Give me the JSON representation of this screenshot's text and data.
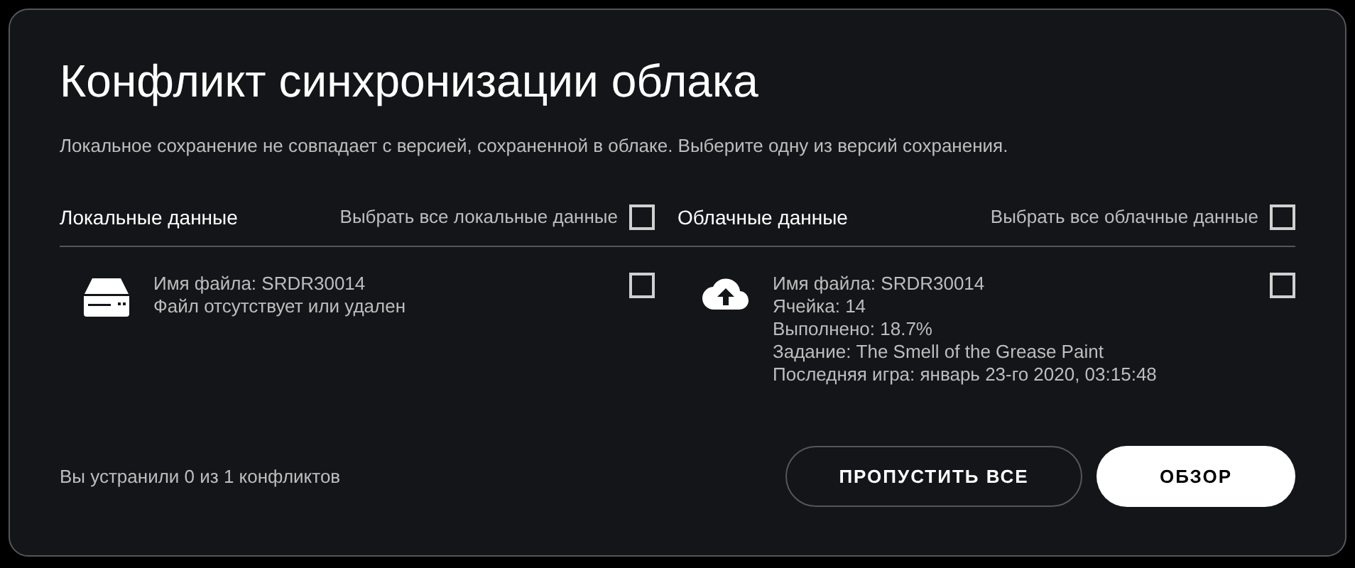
{
  "dialog": {
    "title": "Конфликт синхронизации облака",
    "message": "Локальное сохранение не совпадает с версией, сохраненной в облаке. Выберите одну из версий сохранения.",
    "columns": [
      {
        "kind": "local",
        "heading": "Локальные данные",
        "select_all": {
          "label": "Выбрать все локальные данные",
          "checked": false
        },
        "entry": {
          "checked": false,
          "lines": [
            "Имя файла: SRDR30014",
            "Файл отсутствует или удален"
          ]
        }
      },
      {
        "kind": "cloud",
        "heading": "Облачные данные",
        "select_all": {
          "label": "Выбрать все облачные данные",
          "checked": false
        },
        "entry": {
          "checked": false,
          "lines": [
            "Имя файла: SRDR30014",
            "Ячейка: 14",
            "Выполнено: 18.7%",
            "Задание: The Smell of the Grease Paint",
            "Последняя игра: январь 23-го 2020, 03:15:48"
          ]
        }
      }
    ],
    "status": "Вы устранили 0 из 1 конфликтов",
    "buttons": [
      {
        "label": "ПРОПУСТИТЬ ВСЕ",
        "kind": "secondary"
      },
      {
        "label": "ОБЗОР",
        "kind": "primary"
      }
    ]
  }
}
